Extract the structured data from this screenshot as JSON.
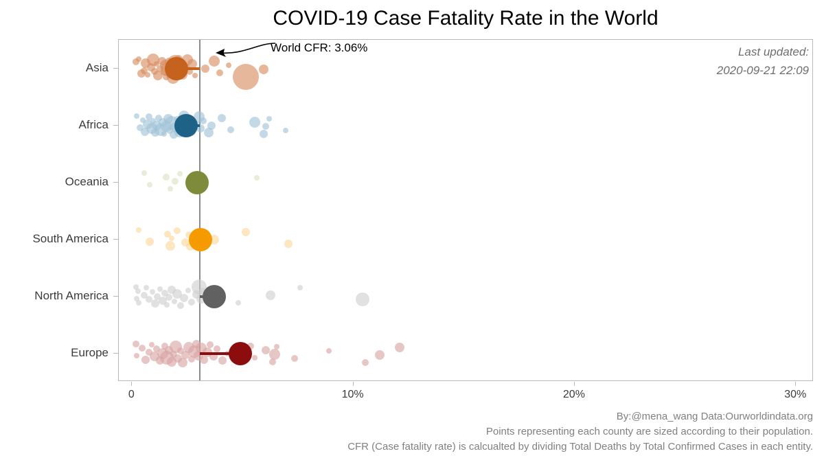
{
  "title": "COVID-19 Case Fatality Rate in the World",
  "annotation": {
    "cfr_label": "World CFR: 3.06%",
    "cfr_value": 3.06,
    "arrow_icon": "curved-left-arrow-icon"
  },
  "last_updated": {
    "label": "Last updated:",
    "timestamp": "2020-09-21 22:09"
  },
  "caption": {
    "line1": "By:@mena_wang  Data:Ourworldindata.org",
    "line2": "Points representing each county are sized according to their population.",
    "line3": "CFR (Case fatality rate) is calcualted by dividing Total Deaths by Total Confirmed Cases in each entity."
  },
  "axis": {
    "x_ticks": [
      "0",
      "10%",
      "20%",
      "30%"
    ],
    "x_tick_values": [
      0,
      10,
      20,
      30
    ],
    "y_categories": [
      "Asia",
      "Africa",
      "Oceania",
      "South America",
      "North America",
      "Europe"
    ]
  },
  "chart_data": {
    "type": "scatter",
    "title": "COVID-19 Case Fatality Rate in the World",
    "xlabel": "",
    "ylabel": "",
    "xlim": [
      -0.6,
      30.8
    ],
    "grid": false,
    "legend": null,
    "reference_line": {
      "name": "World CFR",
      "value": 3.06,
      "color": "#8c8c8c"
    },
    "note": "Dot size encodes country population; large dot per continent is the continent mean CFR, connected by a segment to the World CFR line.",
    "series": [
      {
        "name": "Asia",
        "color": "#C4621E",
        "point_color": "#D98B5F",
        "mean": 2.0,
        "points": [
          {
            "x": 0.3,
            "r": 4
          },
          {
            "x": 0.55,
            "r": 5
          },
          {
            "x": 0.62,
            "r": 7
          },
          {
            "x": 0.7,
            "r": 4
          },
          {
            "x": 0.85,
            "r": 6
          },
          {
            "x": 0.95,
            "r": 9
          },
          {
            "x": 1.0,
            "r": 5
          },
          {
            "x": 1.1,
            "r": 4
          },
          {
            "x": 1.18,
            "r": 7
          },
          {
            "x": 1.25,
            "r": 5
          },
          {
            "x": 1.35,
            "r": 6
          },
          {
            "x": 1.42,
            "r": 4
          },
          {
            "x": 1.5,
            "r": 8
          },
          {
            "x": 1.55,
            "r": 5
          },
          {
            "x": 1.6,
            "r": 10
          },
          {
            "x": 1.65,
            "r": 6
          },
          {
            "x": 1.72,
            "r": 7
          },
          {
            "x": 1.78,
            "r": 5
          },
          {
            "x": 1.85,
            "r": 9
          },
          {
            "x": 1.9,
            "r": 6
          },
          {
            "x": 1.95,
            "r": 11
          },
          {
            "x": 2.0,
            "r": 7
          },
          {
            "x": 2.05,
            "r": 8
          },
          {
            "x": 2.1,
            "r": 6
          },
          {
            "x": 2.15,
            "r": 9
          },
          {
            "x": 2.22,
            "r": 5
          },
          {
            "x": 2.3,
            "r": 7
          },
          {
            "x": 2.4,
            "r": 6
          },
          {
            "x": 2.5,
            "r": 8
          },
          {
            "x": 2.6,
            "r": 5
          },
          {
            "x": 2.72,
            "r": 7
          },
          {
            "x": 2.85,
            "r": 4
          },
          {
            "x": 3.3,
            "r": 6
          },
          {
            "x": 3.7,
            "r": 8
          },
          {
            "x": 3.95,
            "r": 5
          },
          {
            "x": 4.35,
            "r": 4
          },
          {
            "x": 5.15,
            "r": 19
          },
          {
            "x": 5.95,
            "r": 7
          },
          {
            "x": 0.18,
            "r": 5
          },
          {
            "x": 0.42,
            "r": 6
          }
        ]
      },
      {
        "name": "Africa",
        "color": "#1F6287",
        "point_color": "#9FC2D6",
        "mean": 2.45,
        "points": [
          {
            "x": 0.2,
            "r": 4
          },
          {
            "x": 0.35,
            "r": 5
          },
          {
            "x": 0.48,
            "r": 4
          },
          {
            "x": 0.58,
            "r": 6
          },
          {
            "x": 0.7,
            "r": 7
          },
          {
            "x": 0.78,
            "r": 5
          },
          {
            "x": 0.88,
            "r": 8
          },
          {
            "x": 0.95,
            "r": 4
          },
          {
            "x": 1.05,
            "r": 6
          },
          {
            "x": 1.12,
            "r": 7
          },
          {
            "x": 1.2,
            "r": 5
          },
          {
            "x": 1.3,
            "r": 9
          },
          {
            "x": 1.38,
            "r": 6
          },
          {
            "x": 1.45,
            "r": 4
          },
          {
            "x": 1.55,
            "r": 8
          },
          {
            "x": 1.62,
            "r": 7
          },
          {
            "x": 1.7,
            "r": 5
          },
          {
            "x": 1.8,
            "r": 10
          },
          {
            "x": 1.88,
            "r": 6
          },
          {
            "x": 1.95,
            "r": 7
          },
          {
            "x": 2.05,
            "r": 5
          },
          {
            "x": 2.15,
            "r": 9
          },
          {
            "x": 2.25,
            "r": 6
          },
          {
            "x": 2.35,
            "r": 8
          },
          {
            "x": 2.45,
            "r": 5
          },
          {
            "x": 2.55,
            "r": 7
          },
          {
            "x": 2.7,
            "r": 6
          },
          {
            "x": 2.9,
            "r": 5
          },
          {
            "x": 3.02,
            "r": 8
          },
          {
            "x": 3.1,
            "r": 6
          },
          {
            "x": 3.22,
            "r": 5
          },
          {
            "x": 3.45,
            "r": 7
          },
          {
            "x": 3.6,
            "r": 6
          },
          {
            "x": 4.05,
            "r": 6
          },
          {
            "x": 4.45,
            "r": 5
          },
          {
            "x": 5.55,
            "r": 8
          },
          {
            "x": 5.95,
            "r": 6
          },
          {
            "x": 6.05,
            "r": 5
          },
          {
            "x": 6.2,
            "r": 4
          },
          {
            "x": 6.95,
            "r": 4
          }
        ]
      },
      {
        "name": "Oceania",
        "color": "#7D8B3A",
        "point_color": "#DDE0C4",
        "mean": 2.95,
        "points": [
          {
            "x": 0.55,
            "r": 4
          },
          {
            "x": 0.8,
            "r": 4
          },
          {
            "x": 1.55,
            "r": 5
          },
          {
            "x": 1.72,
            "r": 4
          },
          {
            "x": 1.95,
            "r": 5
          },
          {
            "x": 2.15,
            "r": 4
          },
          {
            "x": 3.25,
            "r": 5
          },
          {
            "x": 5.65,
            "r": 4
          }
        ]
      },
      {
        "name": "South America",
        "color": "#F59A00",
        "point_color": "#FBD79A",
        "mean": 3.1,
        "points": [
          {
            "x": 0.3,
            "r": 4
          },
          {
            "x": 0.8,
            "r": 6
          },
          {
            "x": 1.6,
            "r": 5
          },
          {
            "x": 1.72,
            "r": 7
          },
          {
            "x": 1.8,
            "r": 4
          },
          {
            "x": 2.05,
            "r": 5
          },
          {
            "x": 2.4,
            "r": 6
          },
          {
            "x": 2.55,
            "r": 5
          },
          {
            "x": 2.62,
            "r": 6
          },
          {
            "x": 3.7,
            "r": 7
          },
          {
            "x": 5.15,
            "r": 6
          },
          {
            "x": 7.05,
            "r": 6
          }
        ]
      },
      {
        "name": "North America",
        "color": "#616161",
        "point_color": "#CFCFCF",
        "mean": 3.7,
        "points": [
          {
            "x": 0.18,
            "r": 4
          },
          {
            "x": 0.22,
            "r": 4
          },
          {
            "x": 0.26,
            "r": 4
          },
          {
            "x": 0.3,
            "r": 4
          },
          {
            "x": 0.55,
            "r": 5
          },
          {
            "x": 0.65,
            "r": 4
          },
          {
            "x": 0.78,
            "r": 5
          },
          {
            "x": 0.92,
            "r": 4
          },
          {
            "x": 1.05,
            "r": 6
          },
          {
            "x": 1.15,
            "r": 5
          },
          {
            "x": 1.25,
            "r": 4
          },
          {
            "x": 1.38,
            "r": 6
          },
          {
            "x": 1.48,
            "r": 5
          },
          {
            "x": 1.58,
            "r": 4
          },
          {
            "x": 1.68,
            "r": 5
          },
          {
            "x": 1.8,
            "r": 6
          },
          {
            "x": 1.92,
            "r": 4
          },
          {
            "x": 2.05,
            "r": 7
          },
          {
            "x": 2.18,
            "r": 5
          },
          {
            "x": 2.35,
            "r": 6
          },
          {
            "x": 2.52,
            "r": 4
          },
          {
            "x": 2.7,
            "r": 5
          },
          {
            "x": 2.92,
            "r": 6
          },
          {
            "x": 3.02,
            "r": 11
          },
          {
            "x": 3.12,
            "r": 7
          },
          {
            "x": 3.2,
            "r": 5
          },
          {
            "x": 4.8,
            "r": 4
          },
          {
            "x": 6.25,
            "r": 7
          },
          {
            "x": 7.6,
            "r": 4
          },
          {
            "x": 10.4,
            "r": 10
          }
        ]
      },
      {
        "name": "Europe",
        "color": "#8B0D0D",
        "point_color": "#D8A3A3",
        "mean": 4.9,
        "points": [
          {
            "x": 0.18,
            "r": 5
          },
          {
            "x": 0.22,
            "r": 4
          },
          {
            "x": 0.45,
            "r": 5
          },
          {
            "x": 0.62,
            "r": 6
          },
          {
            "x": 0.75,
            "r": 5
          },
          {
            "x": 0.88,
            "r": 4
          },
          {
            "x": 1.0,
            "r": 7
          },
          {
            "x": 1.12,
            "r": 5
          },
          {
            "x": 1.25,
            "r": 6
          },
          {
            "x": 1.38,
            "r": 8
          },
          {
            "x": 1.48,
            "r": 5
          },
          {
            "x": 1.58,
            "r": 10
          },
          {
            "x": 1.68,
            "r": 6
          },
          {
            "x": 1.78,
            "r": 7
          },
          {
            "x": 1.88,
            "r": 5
          },
          {
            "x": 1.98,
            "r": 9
          },
          {
            "x": 2.08,
            "r": 6
          },
          {
            "x": 2.18,
            "r": 5
          },
          {
            "x": 2.3,
            "r": 7
          },
          {
            "x": 2.42,
            "r": 6
          },
          {
            "x": 2.55,
            "r": 8
          },
          {
            "x": 2.68,
            "r": 5
          },
          {
            "x": 2.82,
            "r": 9
          },
          {
            "x": 2.92,
            "r": 6
          },
          {
            "x": 3.0,
            "r": 7
          },
          {
            "x": 3.12,
            "r": 8
          },
          {
            "x": 3.25,
            "r": 6
          },
          {
            "x": 3.4,
            "r": 7
          },
          {
            "x": 3.52,
            "r": 5
          },
          {
            "x": 3.68,
            "r": 6
          },
          {
            "x": 3.85,
            "r": 5
          },
          {
            "x": 4.1,
            "r": 6
          },
          {
            "x": 4.3,
            "r": 4
          },
          {
            "x": 5.35,
            "r": 5
          },
          {
            "x": 5.55,
            "r": 4
          },
          {
            "x": 6.05,
            "r": 6
          },
          {
            "x": 6.35,
            "r": 5
          },
          {
            "x": 6.45,
            "r": 8
          },
          {
            "x": 6.55,
            "r": 4
          },
          {
            "x": 7.35,
            "r": 5
          },
          {
            "x": 8.9,
            "r": 4
          },
          {
            "x": 10.55,
            "r": 5
          },
          {
            "x": 11.2,
            "r": 7
          },
          {
            "x": 12.1,
            "r": 7
          }
        ]
      }
    ]
  }
}
